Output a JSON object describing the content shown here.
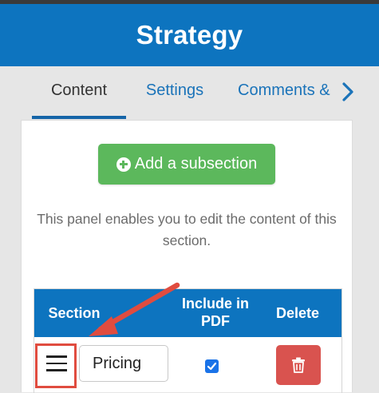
{
  "header": {
    "title": "Strategy"
  },
  "tabs": [
    {
      "label": "Content",
      "active": true
    },
    {
      "label": "Settings",
      "active": false
    },
    {
      "label": "Comments &",
      "active": false
    }
  ],
  "panel": {
    "add_button_label": "Add a subsection",
    "description": "This panel enables you to edit the content of this section.",
    "table": {
      "columns": [
        "Section",
        "Include in PDF",
        "Delete"
      ],
      "rows": [
        {
          "section_name": "Pricing",
          "include_in_pdf": true
        }
      ]
    }
  },
  "colors": {
    "brand_blue": "#0d74bf",
    "add_green": "#5cb85c",
    "delete_red": "#d9534f",
    "annotation_red": "#e04c3f"
  },
  "icons": [
    "plus-circle-icon",
    "chevron-right-icon",
    "drag-handle-icon",
    "checkmark-icon",
    "trash-icon",
    "annotation-arrow"
  ]
}
